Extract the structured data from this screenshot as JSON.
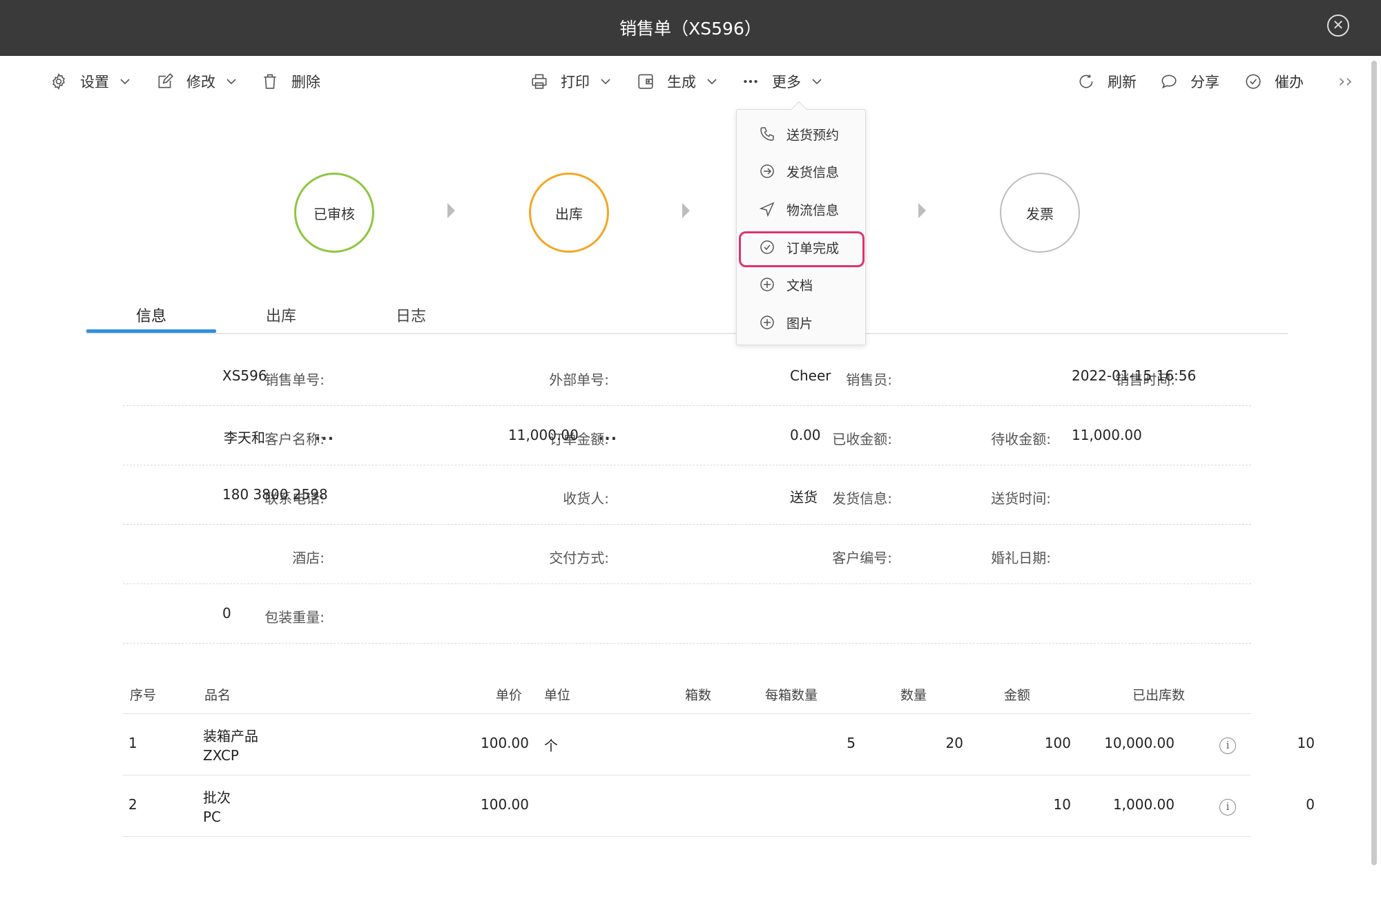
{
  "window": {
    "title": "销售单（XS596）"
  },
  "toolbar": {
    "settings": "设置",
    "edit": "修改",
    "delete": "删除",
    "print": "打印",
    "generate": "生成",
    "more": "更多",
    "refresh": "刷新",
    "share": "分享",
    "urge": "催办",
    "expand": "››"
  },
  "more_menu": {
    "items": [
      "送货预约",
      "发货信息",
      "物流信息",
      "订单完成",
      "文档",
      "图片"
    ],
    "highlighted": "订单完成",
    "highlight_color": "#e0326e"
  },
  "steps": [
    {
      "label": "已审核",
      "color": "#8dc63f"
    },
    {
      "label": "出库",
      "color": "#f5a623"
    },
    {
      "label": "发票",
      "color": "#bdbdbd"
    }
  ],
  "tabs": [
    "信息",
    "出库",
    "日志"
  ],
  "active_tab": "信息",
  "accent_color": "#2f8fdc",
  "info": {
    "sale_no_label": "销售单号:",
    "sale_no": "XS596",
    "ext_no_label": "外部单号:",
    "ext_no": "",
    "seller_label": "销售员:",
    "seller": "Cheer",
    "sale_time_label": "销售时间:",
    "sale_time": "2022-01-15 16:56",
    "customer_label": "客户名称:",
    "customer": "李天和",
    "order_amount_label": "订单金额:",
    "order_amount": "11,000.00",
    "received_label": "已收金额:",
    "received": "0.00",
    "pending_label": "待收金额:",
    "pending": "11,000.00",
    "phone_label": "联系电话:",
    "phone": "180 3800 2598",
    "consignee_label": "收货人:",
    "consignee": "",
    "ship_info_label": "发货信息:",
    "ship_info": "送货",
    "ship_time_label": "送货时间:",
    "ship_time": "",
    "hotel_label": "酒店:",
    "hotel": "",
    "delivery_label": "交付方式:",
    "delivery": "",
    "cust_no_label": "客户编号:",
    "cust_no": "",
    "wedding_label": "婚礼日期:",
    "wedding": "",
    "weight_label": "包装重量:",
    "weight": "0",
    "ellipsis": "..."
  },
  "table": {
    "headers": [
      "序号",
      "品名",
      "单价",
      "单位",
      "箱数",
      "每箱数量",
      "数量",
      "金额",
      "已出库数"
    ],
    "rows": [
      {
        "no": "1",
        "name": "装箱产品",
        "code": "ZXCP",
        "price": "100.00",
        "unit": "个",
        "boxes": "5",
        "per_box": "20",
        "qty": "100",
        "amount": "10,000.00",
        "shipped": "10"
      },
      {
        "no": "2",
        "name": "批次",
        "code": "PC",
        "price": "100.00",
        "unit": "",
        "boxes": "",
        "per_box": "",
        "qty": "10",
        "amount": "1,000.00",
        "shipped": "0"
      }
    ],
    "info_icon": "i"
  }
}
